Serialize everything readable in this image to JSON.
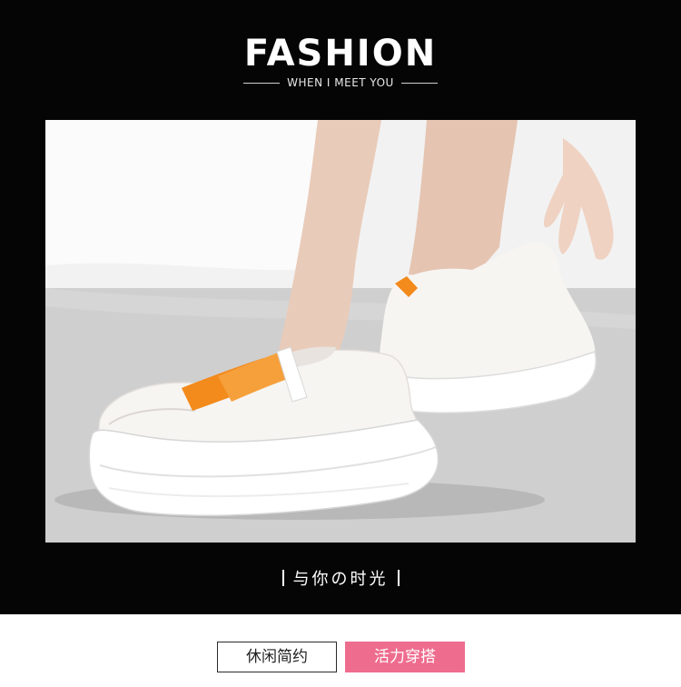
{
  "header": {
    "title": "FASHION",
    "subtitle": "WHEN I MEET YOU"
  },
  "photo": {
    "subject": "white-platform-sneakers-orange-straps"
  },
  "caption": {
    "text": "与你の时光"
  },
  "tags": {
    "casual": "休闲简约",
    "vibrant": "活力穿搭"
  },
  "colors": {
    "background_top": "#050505",
    "accent_orange": "#f28a1c",
    "tag_pink": "#ee6c8e",
    "shoe_white": "#f7f5f2"
  }
}
